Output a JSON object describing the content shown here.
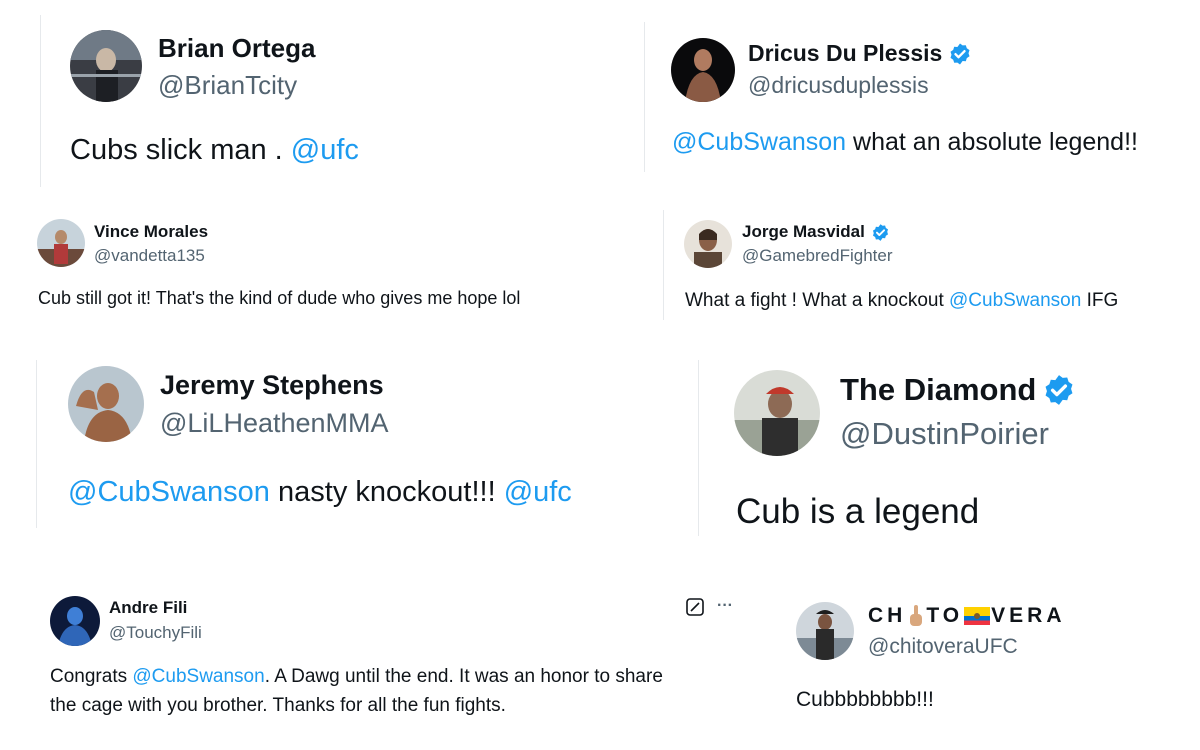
{
  "colors": {
    "mention": "#1d9bf0",
    "handle": "#536471",
    "text": "#0f1419",
    "verified": "#1d9bf0"
  },
  "tweets": [
    {
      "name": "Brian Ortega",
      "handle": "@BrianTcity",
      "verified": false,
      "text_before": "Cubs slick man . ",
      "mention": "@ufc",
      "text_after": ""
    },
    {
      "name": "Dricus Du Plessis",
      "handle": "@dricusduplessis",
      "verified": true,
      "mention": "@CubSwanson",
      "text_after": " what an absolute legend!!"
    },
    {
      "name": "Vince Morales",
      "handle": "@vandetta135",
      "verified": false,
      "text": "Cub still got it! That's the kind of dude who gives me hope lol"
    },
    {
      "name": "Jorge Masvidal",
      "handle": "@GamebredFighter",
      "verified": true,
      "text_before": "What a fight ! What a knockout ",
      "mention": "@CubSwanson",
      "text_after": " IFG"
    },
    {
      "name": "Jeremy Stephens",
      "handle": "@LiLHeathenMMA",
      "verified": false,
      "mention": "@CubSwanson",
      "text_middle": " nasty knockout!!! ",
      "mention2": "@ufc"
    },
    {
      "name": "The Diamond",
      "handle": "@DustinPoirier",
      "verified": true,
      "text": "Cub is a legend"
    },
    {
      "name": "Andre Fili",
      "handle": "@TouchyFili",
      "verified": false,
      "line1_before": "Congrats ",
      "mention": "@CubSwanson",
      "line1_after": ". A Dawg until the end. It was an honor to share",
      "line2": "the cage with you brother. Thanks for all the fun fights.",
      "icons": {
        "edit": "grok-edit-icon",
        "more": "more-icon",
        "more_glyph": "···"
      }
    },
    {
      "name_part1": "CH",
      "name_part2": "TO",
      "name_part3": "VERA",
      "name_emoji1": "middle-finger-emoji",
      "name_emoji2": "ecuador-flag-emoji",
      "handle": "@chitoveraUFC",
      "verified": false,
      "text": "Cubbbbbbbb!!!"
    }
  ]
}
